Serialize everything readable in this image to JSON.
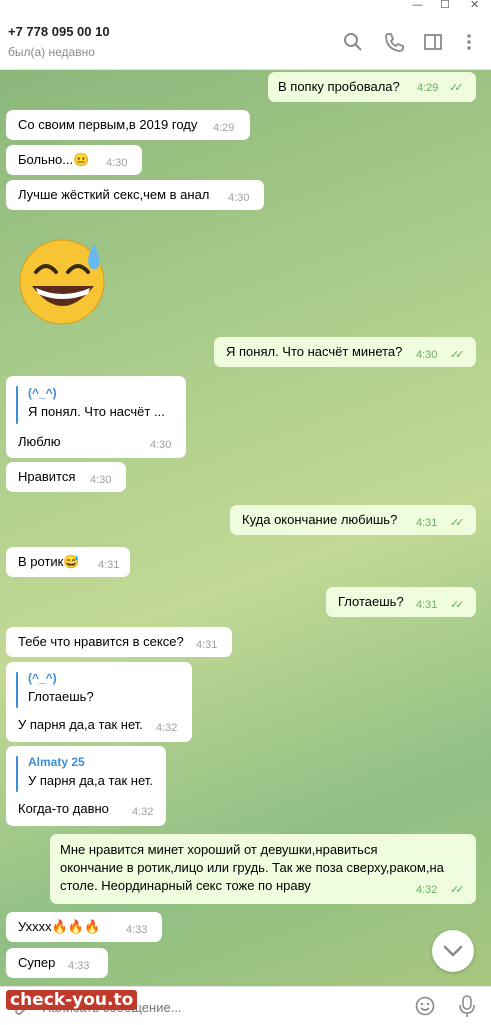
{
  "window": {
    "minimize": "—",
    "maximize": "☐",
    "close": "✕"
  },
  "header": {
    "name": "+7 778 095 00 10",
    "status": "был(а) недавно"
  },
  "messages": [
    {
      "text": "В попку пробовала?",
      "time": "4:29"
    },
    {
      "text": "Со своим первым,в 2019 году",
      "time": "4:29"
    },
    {
      "text": "Больно...",
      "emoji": "😐",
      "time": "4:30"
    },
    {
      "text": "Лучше жёсткий секс,чем в анал",
      "time": "4:30"
    },
    {
      "text": "Я понял. Что насчёт минета?",
      "time": "4:30"
    },
    {
      "reply_name": "(^_^)",
      "reply_text": "Я понял. Что насчёт ...",
      "text": "Люблю",
      "time": "4:30"
    },
    {
      "text": "Нравится",
      "time": "4:30"
    },
    {
      "text": "Куда окончание любишь?",
      "time": "4:31"
    },
    {
      "text": "В ротик",
      "emoji": "😅",
      "time": "4:31"
    },
    {
      "text": "Глотаешь?",
      "time": "4:31"
    },
    {
      "text": "Тебе что нравится в сексе?",
      "time": "4:31"
    },
    {
      "reply_name": "(^_^)",
      "reply_text": "Глотаешь?",
      "text": "У парня да,а так нет.",
      "time": "4:32"
    },
    {
      "reply_name": "Almaty 25",
      "reply_text": "У парня да,а так нет.",
      "text": "Когда-то давно",
      "time": "4:32"
    },
    {
      "lines": [
        "Мне нравится минет хороший от девушки,нравиться",
        "окончание в ротик,лицо или грудь. Так же поза сверху,раком,на",
        "столе. Неординарный секс тоже по нраву"
      ],
      "time": "4:32"
    },
    {
      "text": "Ухххх",
      "emoji": "🔥🔥🔥",
      "time": "4:33"
    },
    {
      "text": "Супер",
      "time": "4:33"
    }
  ],
  "input": {
    "placeholder": "Написать сообщение..."
  },
  "watermark": "check-you.to",
  "colors": {
    "accent": "#3d8ed6",
    "outgoing": "#effdde",
    "check": "#5fb157"
  }
}
